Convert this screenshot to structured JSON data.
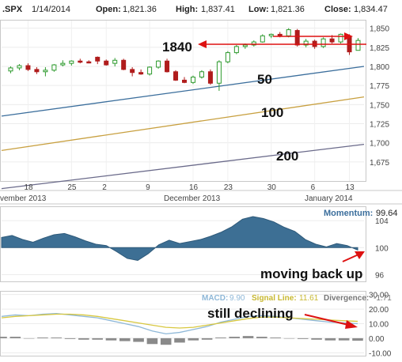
{
  "header": {
    "symbol": ".SPX",
    "date": "1/14/2014",
    "open_label": "Open:",
    "open": "1,821.36",
    "high_label": "High:",
    "high": "1,837.41",
    "low_label": "Low:",
    "low": "1,821.36",
    "close_label": "Close:",
    "close": "1,834.47"
  },
  "chart_data": [
    {
      "type": "candlestick",
      "ylim": [
        1650,
        1860
      ],
      "yticks": [
        1675,
        1700,
        1725,
        1750,
        1775,
        1800,
        1825,
        1850
      ],
      "ytick_labels": [
        "1,675",
        "1,700",
        "1,725",
        "1,750",
        "1,775",
        "1,800",
        "1,825",
        "1,850"
      ],
      "xtick_labels": [
        "18",
        "25",
        "2",
        "9",
        "16",
        "23",
        "30",
        "6",
        "13"
      ],
      "month_labels": [
        "vember 2013",
        "December 2013",
        "January 2014"
      ],
      "candles": [
        {
          "o": 1794,
          "h": 1800,
          "l": 1791,
          "c": 1798
        },
        {
          "o": 1798,
          "h": 1803,
          "l": 1795,
          "c": 1801
        },
        {
          "o": 1801,
          "h": 1804,
          "l": 1794,
          "c": 1796
        },
        {
          "o": 1796,
          "h": 1799,
          "l": 1790,
          "c": 1793
        },
        {
          "o": 1793,
          "h": 1799,
          "l": 1787,
          "c": 1795
        },
        {
          "o": 1795,
          "h": 1803,
          "l": 1793,
          "c": 1802
        },
        {
          "o": 1802,
          "h": 1808,
          "l": 1800,
          "c": 1804
        },
        {
          "o": 1804,
          "h": 1808,
          "l": 1801,
          "c": 1807
        },
        {
          "o": 1807,
          "h": 1810,
          "l": 1804,
          "c": 1806
        },
        {
          "o": 1806,
          "h": 1808,
          "l": 1804,
          "c": 1805
        },
        {
          "o": 1812,
          "h": 1813,
          "l": 1803,
          "c": 1807
        },
        {
          "o": 1807,
          "h": 1809,
          "l": 1801,
          "c": 1802
        },
        {
          "o": 1804,
          "h": 1811,
          "l": 1800,
          "c": 1808
        },
        {
          "o": 1808,
          "h": 1810,
          "l": 1795,
          "c": 1796
        },
        {
          "o": 1796,
          "h": 1799,
          "l": 1787,
          "c": 1792
        },
        {
          "o": 1792,
          "h": 1796,
          "l": 1789,
          "c": 1790
        },
        {
          "o": 1790,
          "h": 1800,
          "l": 1788,
          "c": 1799
        },
        {
          "o": 1799,
          "h": 1808,
          "l": 1797,
          "c": 1807
        },
        {
          "o": 1807,
          "h": 1810,
          "l": 1792,
          "c": 1793
        },
        {
          "o": 1793,
          "h": 1795,
          "l": 1781,
          "c": 1782
        },
        {
          "o": 1782,
          "h": 1786,
          "l": 1778,
          "c": 1779
        },
        {
          "o": 1779,
          "h": 1788,
          "l": 1777,
          "c": 1786
        },
        {
          "o": 1786,
          "h": 1795,
          "l": 1784,
          "c": 1793
        },
        {
          "o": 1793,
          "h": 1796,
          "l": 1776,
          "c": 1778
        },
        {
          "o": 1778,
          "h": 1808,
          "l": 1768,
          "c": 1806
        },
        {
          "o": 1806,
          "h": 1820,
          "l": 1804,
          "c": 1818
        },
        {
          "o": 1818,
          "h": 1828,
          "l": 1816,
          "c": 1826
        },
        {
          "o": 1826,
          "h": 1830,
          "l": 1823,
          "c": 1828
        },
        {
          "o": 1828,
          "h": 1834,
          "l": 1826,
          "c": 1832
        },
        {
          "o": 1832,
          "h": 1842,
          "l": 1831,
          "c": 1840
        },
        {
          "o": 1840,
          "h": 1843,
          "l": 1837,
          "c": 1842
        },
        {
          "o": 1842,
          "h": 1845,
          "l": 1838,
          "c": 1840
        },
        {
          "o": 1840,
          "h": 1850,
          "l": 1838,
          "c": 1848
        },
        {
          "o": 1847,
          "h": 1849,
          "l": 1826,
          "c": 1828
        },
        {
          "o": 1828,
          "h": 1836,
          "l": 1825,
          "c": 1833
        },
        {
          "o": 1833,
          "h": 1835,
          "l": 1823,
          "c": 1826
        },
        {
          "o": 1826,
          "h": 1838,
          "l": 1824,
          "c": 1836
        },
        {
          "o": 1836,
          "h": 1841,
          "l": 1830,
          "c": 1832
        },
        {
          "o": 1832,
          "h": 1843,
          "l": 1830,
          "c": 1842
        },
        {
          "o": 1838,
          "h": 1842,
          "l": 1815,
          "c": 1819
        },
        {
          "o": 1821,
          "h": 1837,
          "l": 1821,
          "c": 1834
        }
      ],
      "moving_averages": [
        {
          "name": "50",
          "color": "#3b6e9c",
          "values": [
            1735,
            1800
          ]
        },
        {
          "name": "100",
          "color": "#c8a040",
          "values": [
            1690,
            1760
          ]
        },
        {
          "name": "200",
          "color": "#6a6a8a",
          "values": [
            1640,
            1698
          ]
        }
      ],
      "annotations": {
        "level_label": "1840",
        "ma50_label": "50",
        "ma100_label": "100",
        "ma200_label": "200"
      }
    },
    {
      "type": "area",
      "name": "Momentum",
      "title_label": "Momentum:",
      "value_label": "99.64",
      "baseline": 100,
      "ylim": [
        95,
        106
      ],
      "yticks": [
        96,
        100,
        104
      ],
      "values": [
        101.5,
        101.8,
        101.2,
        100.8,
        101.4,
        101.9,
        102.1,
        101.6,
        101,
        100.5,
        100.3,
        99.4,
        98.4,
        98.1,
        99.1,
        100.4,
        101.1,
        100.6,
        100.9,
        101.2,
        101.7,
        102.3,
        103.1,
        104.2,
        104.6,
        104.3,
        103.8,
        103,
        102.4,
        101.2,
        100.5,
        100.1,
        100.6,
        100.3,
        99.64
      ],
      "annotation": "moving back up"
    },
    {
      "type": "line",
      "name": "MACD",
      "macd_label": "MACD:",
      "macd_value": "9.90",
      "signal_label": "Signal Line:",
      "signal_value": "11.61",
      "divergence_label": "Divergence:",
      "divergence_value": "-1.71",
      "ylim": [
        -12,
        32
      ],
      "yticks": [
        -10,
        0,
        10,
        20,
        30
      ],
      "ytick_labels": [
        "-10.00",
        "0.00",
        "10.00",
        "20.00",
        "30.00"
      ],
      "series": [
        {
          "color": "#8fb8d8",
          "values": [
            15,
            16,
            15.5,
            16.5,
            17,
            16,
            15,
            14,
            12,
            10,
            8,
            5,
            3,
            4,
            6,
            8,
            11,
            13,
            15,
            15.5,
            15,
            14,
            13,
            12,
            11,
            10.5,
            10
          ]
        },
        {
          "color": "#d8c840",
          "values": [
            14,
            15,
            15.5,
            16,
            16.5,
            16.5,
            16,
            15,
            13.5,
            12,
            10.5,
            9,
            7.5,
            7,
            7.5,
            9,
            10.5,
            12,
            13.5,
            14.5,
            14.5,
            14,
            13.5,
            13,
            12.5,
            12,
            11.6
          ]
        }
      ],
      "divergence": [
        1,
        1,
        0,
        0.5,
        0.5,
        -0.5,
        -1,
        -1,
        -1.5,
        -2,
        -2.5,
        -4,
        -4.5,
        -3,
        -1.5,
        -1,
        0.5,
        1,
        1.5,
        1,
        0.5,
        0,
        -0.5,
        -1,
        -1.5,
        -1.5,
        -1.7
      ],
      "annotation": "still declining"
    }
  ]
}
